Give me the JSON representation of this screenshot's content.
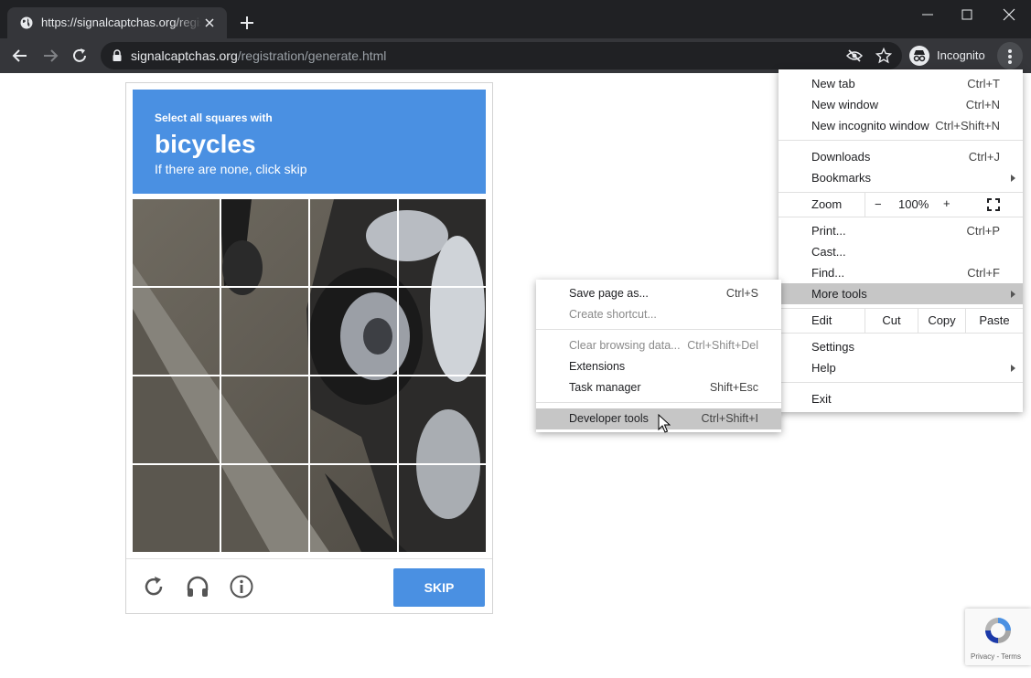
{
  "browser": {
    "tab_title": "https://signalcaptchas.org/registr",
    "url_host": "signalcaptchas.org",
    "url_path": "/registration/generate.html",
    "incognito_label": "Incognito",
    "icons": [
      "globe-icon",
      "close-icon",
      "plus-icon",
      "minimize-icon",
      "maximize-icon",
      "window-close-icon",
      "back-arrow-icon",
      "forward-arrow-icon",
      "reload-icon",
      "lock-icon",
      "eye-slash-icon",
      "star-icon",
      "incognito-icon",
      "kebab-menu-icon"
    ]
  },
  "captcha": {
    "instruction": "Select all squares with",
    "target": "bicycles",
    "hint": "If there are none, click skip",
    "skip_label": "SKIP",
    "footer_icons": [
      "reload-icon",
      "headphones-icon",
      "info-icon"
    ],
    "header_color": "#4a90e2"
  },
  "recaptcha_badge": {
    "links": "Privacy - Terms"
  },
  "menu": {
    "items": [
      {
        "label": "New tab",
        "shortcut": "Ctrl+T"
      },
      {
        "label": "New window",
        "shortcut": "Ctrl+N"
      },
      {
        "label": "New incognito window",
        "shortcut": "Ctrl+Shift+N"
      },
      {
        "label": "Downloads",
        "shortcut": "Ctrl+J"
      },
      {
        "label": "Bookmarks",
        "shortcut": ""
      },
      {
        "label": "Print...",
        "shortcut": "Ctrl+P"
      },
      {
        "label": "Cast...",
        "shortcut": ""
      },
      {
        "label": "Find...",
        "shortcut": "Ctrl+F"
      },
      {
        "label": "More tools",
        "shortcut": ""
      },
      {
        "label": "Settings",
        "shortcut": ""
      },
      {
        "label": "Help",
        "shortcut": ""
      },
      {
        "label": "Exit",
        "shortcut": ""
      }
    ],
    "zoom": {
      "label": "Zoom",
      "minus": "−",
      "value": "100%",
      "plus": "+"
    },
    "edit": {
      "label": "Edit",
      "cut": "Cut",
      "copy": "Copy",
      "paste": "Paste"
    }
  },
  "submenu": {
    "items": [
      {
        "label": "Save page as...",
        "shortcut": "Ctrl+S"
      },
      {
        "label": "Create shortcut...",
        "shortcut": ""
      },
      {
        "label": "Clear browsing data...",
        "shortcut": "Ctrl+Shift+Del"
      },
      {
        "label": "Extensions",
        "shortcut": ""
      },
      {
        "label": "Task manager",
        "shortcut": "Shift+Esc"
      },
      {
        "label": "Developer tools",
        "shortcut": "Ctrl+Shift+I"
      }
    ]
  }
}
